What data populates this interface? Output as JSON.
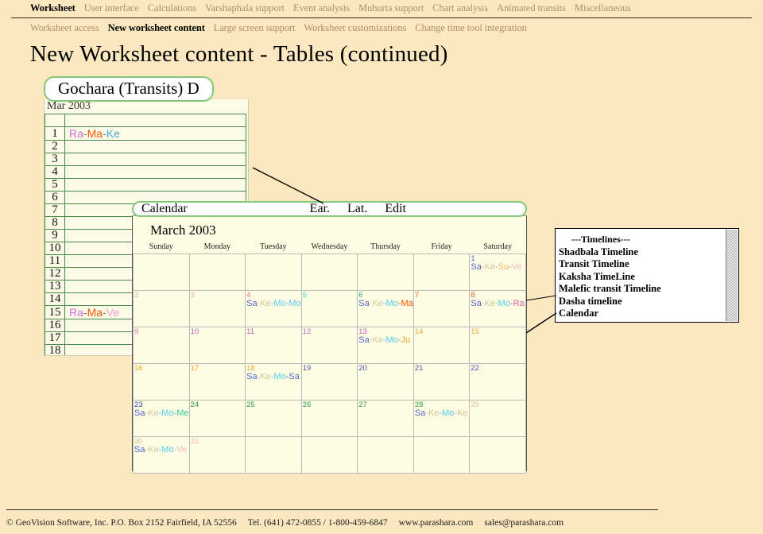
{
  "topnav": {
    "row1": [
      {
        "label": "Worksheet",
        "active": true
      },
      {
        "label": "User interface",
        "active": false
      },
      {
        "label": "Calculations",
        "active": false
      },
      {
        "label": "Varshaphala support",
        "active": false
      },
      {
        "label": "Event analysis",
        "active": false
      },
      {
        "label": "Muhurta support",
        "active": false
      },
      {
        "label": "Chart analysis",
        "active": false
      },
      {
        "label": "Animated transits",
        "active": false
      },
      {
        "label": "Miscellaneous",
        "active": false
      }
    ],
    "row2": [
      {
        "label": "Worksheet access",
        "active": false
      },
      {
        "label": "New worksheet content",
        "active": true
      },
      {
        "label": "Large screen support",
        "active": false
      },
      {
        "label": "Worksheet customizations",
        "active": false
      },
      {
        "label": "Change time tool integration",
        "active": false
      }
    ]
  },
  "page": {
    "title": "New Worksheet content - Tables (continued)"
  },
  "gochara": {
    "title": "Gochara (Transits) D",
    "month_label": "Mar 2003",
    "rows": [
      {
        "num": "",
        "tokens": []
      },
      {
        "num": "1",
        "tokens": [
          {
            "t": "Ra",
            "c": "#d96ad9"
          },
          {
            "t": "-",
            "c": "#777777"
          },
          {
            "t": "Ma",
            "c": "#ff5500"
          },
          {
            "t": "-",
            "c": "#777777"
          },
          {
            "t": "Ke",
            "c": "#44aadd"
          }
        ]
      },
      {
        "num": "2",
        "tokens": []
      },
      {
        "num": "3",
        "tokens": []
      },
      {
        "num": "4",
        "tokens": []
      },
      {
        "num": "5",
        "tokens": []
      },
      {
        "num": "6",
        "tokens": []
      },
      {
        "num": "7",
        "tokens": []
      },
      {
        "num": "8",
        "tokens": []
      },
      {
        "num": "9",
        "tokens": []
      },
      {
        "num": "10",
        "tokens": []
      },
      {
        "num": "11",
        "tokens": []
      },
      {
        "num": "12",
        "tokens": []
      },
      {
        "num": "13",
        "tokens": []
      },
      {
        "num": "14",
        "tokens": []
      },
      {
        "num": "15",
        "tokens": [
          {
            "t": "Ra",
            "c": "#d96ad9"
          },
          {
            "t": "-",
            "c": "#777777"
          },
          {
            "t": "Ma",
            "c": "#ff5500"
          },
          {
            "t": "-",
            "c": "#777777"
          },
          {
            "t": "Ve",
            "c": "#f49ad0"
          }
        ]
      },
      {
        "num": "16",
        "tokens": []
      },
      {
        "num": "17",
        "tokens": []
      },
      {
        "num": "18",
        "tokens": []
      }
    ]
  },
  "calendar": {
    "window_title": "Calendar",
    "actions": [
      "Ear.",
      "Lat.",
      "Edit"
    ],
    "month_title": "March 2003",
    "weekdays": [
      "Sunday",
      "Monday",
      "Tuesday",
      "Wednesday",
      "Thursday",
      "Friday",
      "Saturday"
    ],
    "weeks": [
      [
        {
          "num": "",
          "color": "",
          "tokens": []
        },
        {
          "num": "",
          "color": "",
          "tokens": []
        },
        {
          "num": "",
          "color": "",
          "tokens": []
        },
        {
          "num": "",
          "color": "",
          "tokens": []
        },
        {
          "num": "",
          "color": "",
          "tokens": []
        },
        {
          "num": "",
          "color": "",
          "tokens": []
        },
        {
          "num": "1",
          "color": "#5566cc",
          "tokens": [
            {
              "t": "Sa",
              "c": "#5566cc"
            },
            {
              "t": "-",
              "c": "#aaaaaa"
            },
            {
              "t": "Ke",
              "c": "#d8c0a0"
            },
            {
              "t": "-",
              "c": "#aaaaaa"
            },
            {
              "t": "Su",
              "c": "#f0b860"
            },
            {
              "t": "-",
              "c": "#aaaaaa"
            },
            {
              "t": "Ve",
              "c": "#f4b8c8"
            }
          ]
        }
      ],
      [
        {
          "num": "2",
          "color": "#f4a8c8",
          "tokens": []
        },
        {
          "num": "3",
          "color": "#f4a8c8",
          "tokens": []
        },
        {
          "num": "4",
          "color": "#f46aa0",
          "tokens": [
            {
              "t": "Sa",
              "c": "#5566cc"
            },
            {
              "t": "-",
              "c": "#d8c0a0"
            },
            {
              "t": "Ke",
              "c": "#d8c0a0"
            },
            {
              "t": "-",
              "c": "#55ccee"
            },
            {
              "t": "Mo",
              "c": "#55ccee"
            },
            {
              "t": "-",
              "c": "#55ccee"
            },
            {
              "t": "Mo",
              "c": "#55ccee"
            }
          ]
        },
        {
          "num": "5",
          "color": "#33ccdd",
          "tokens": []
        },
        {
          "num": "6",
          "color": "#33aa88",
          "tokens": [
            {
              "t": "Sa",
              "c": "#5566cc"
            },
            {
              "t": "-",
              "c": "#d8c0a0"
            },
            {
              "t": "Ke",
              "c": "#d8c0a0"
            },
            {
              "t": "-",
              "c": "#55ccee"
            },
            {
              "t": "Mo",
              "c": "#55ccee"
            },
            {
              "t": "-",
              "c": "#ff5500"
            },
            {
              "t": "Ma",
              "c": "#ff5500"
            }
          ]
        },
        {
          "num": "7",
          "color": "#ee6633",
          "tokens": []
        },
        {
          "num": "8",
          "color": "#ee5522",
          "tokens": [
            {
              "t": "Sa",
              "c": "#5566cc"
            },
            {
              "t": "-",
              "c": "#d8c0a0"
            },
            {
              "t": "Ke",
              "c": "#d8c0a0"
            },
            {
              "t": "-",
              "c": "#55ccee"
            },
            {
              "t": "Mo",
              "c": "#55ccee"
            },
            {
              "t": "-",
              "c": "#e060b0"
            },
            {
              "t": "Ra",
              "c": "#e060b0"
            }
          ]
        }
      ],
      [
        {
          "num": "9",
          "color": "#e070d0",
          "tokens": []
        },
        {
          "num": "10",
          "color": "#c060c0",
          "tokens": []
        },
        {
          "num": "11",
          "color": "#c060c0",
          "tokens": []
        },
        {
          "num": "12",
          "color": "#d070c0",
          "tokens": []
        },
        {
          "num": "13",
          "color": "#cc55bb",
          "tokens": [
            {
              "t": "Sa",
              "c": "#5566cc"
            },
            {
              "t": "-",
              "c": "#d8c0a0"
            },
            {
              "t": "Ke",
              "c": "#d8c0a0"
            },
            {
              "t": "-",
              "c": "#55ccee"
            },
            {
              "t": "Mo",
              "c": "#55ccee"
            },
            {
              "t": "-",
              "c": "#f0a030"
            },
            {
              "t": "Ju",
              "c": "#f0a030"
            }
          ]
        },
        {
          "num": "14",
          "color": "#f0a840",
          "tokens": []
        },
        {
          "num": "15",
          "color": "#f0a840",
          "tokens": []
        }
      ],
      [
        {
          "num": "16",
          "color": "#f0a030",
          "tokens": []
        },
        {
          "num": "17",
          "color": "#f0a030",
          "tokens": []
        },
        {
          "num": "18",
          "color": "#f0a030",
          "tokens": [
            {
              "t": "Sa",
              "c": "#5566cc"
            },
            {
              "t": "-",
              "c": "#d8c0a0"
            },
            {
              "t": "Ke",
              "c": "#d8c0a0"
            },
            {
              "t": "-",
              "c": "#55ccee"
            },
            {
              "t": "Mo",
              "c": "#55ccee"
            },
            {
              "t": "-",
              "c": "#5566cc"
            },
            {
              "t": "Sa",
              "c": "#5566cc"
            }
          ]
        },
        {
          "num": "19",
          "color": "#4455bb",
          "tokens": []
        },
        {
          "num": "20",
          "color": "#4455bb",
          "tokens": []
        },
        {
          "num": "21",
          "color": "#4455bb",
          "tokens": []
        },
        {
          "num": "22",
          "color": "#4455bb",
          "tokens": []
        }
      ],
      [
        {
          "num": "23",
          "color": "#3344bb",
          "tokens": [
            {
              "t": "Sa",
              "c": "#5566cc"
            },
            {
              "t": "-",
              "c": "#d8c0a0"
            },
            {
              "t": "Ke",
              "c": "#d8c0a0"
            },
            {
              "t": "-",
              "c": "#55ccee"
            },
            {
              "t": "Mo",
              "c": "#55ccee"
            },
            {
              "t": "-",
              "c": "#33cc99"
            },
            {
              "t": "Me",
              "c": "#33cc99"
            }
          ]
        },
        {
          "num": "24",
          "color": "#2f9a4f",
          "tokens": []
        },
        {
          "num": "25",
          "color": "#2f9a4f",
          "tokens": []
        },
        {
          "num": "26",
          "color": "#2f9a4f",
          "tokens": []
        },
        {
          "num": "27",
          "color": "#2f9a4f",
          "tokens": []
        },
        {
          "num": "28",
          "color": "#2f9a4f",
          "tokens": [
            {
              "t": "Sa",
              "c": "#5566cc"
            },
            {
              "t": "-",
              "c": "#d8c0a0"
            },
            {
              "t": "Ke",
              "c": "#d8c0a0"
            },
            {
              "t": "-",
              "c": "#55ccee"
            },
            {
              "t": "Mo",
              "c": "#55ccee"
            },
            {
              "t": "-",
              "c": "#d8c0a0"
            },
            {
              "t": "Ke",
              "c": "#d8c0a0"
            }
          ]
        },
        {
          "num": "29",
          "color": "#d8c0a0",
          "tokens": []
        }
      ],
      [
        {
          "num": "30",
          "color": "#d8c0a0",
          "tokens": [
            {
              "t": "Sa",
              "c": "#5566cc"
            },
            {
              "t": "-",
              "c": "#d8c0a0"
            },
            {
              "t": "Ke",
              "c": "#d8c0a0"
            },
            {
              "t": "-",
              "c": "#55ccee"
            },
            {
              "t": "Mo",
              "c": "#55ccee"
            },
            {
              "t": "-",
              "c": "#f4b8c8"
            },
            {
              "t": "Ve",
              "c": "#f4b8c8"
            }
          ]
        },
        {
          "num": "31",
          "color": "#f4b8c8",
          "tokens": []
        },
        {
          "num": "",
          "color": "",
          "tokens": []
        },
        {
          "num": "",
          "color": "",
          "tokens": []
        },
        {
          "num": "",
          "color": "",
          "tokens": []
        },
        {
          "num": "",
          "color": "",
          "tokens": []
        },
        {
          "num": "",
          "color": "",
          "tokens": []
        }
      ]
    ]
  },
  "timelines": {
    "header": "---Timelines---",
    "items": [
      "Shadbala Timeline",
      "Transit Timeline",
      "Kaksha TimeLine",
      "Malefic transit Timeline",
      "Dasha timeline",
      "Calendar"
    ]
  },
  "footer": {
    "segments": [
      "© GeoVision Software, Inc. P.O. Box 2152 Fairfield, IA 52556",
      "Tel. (641) 472-0855 / 1-800-459-6847",
      "www.parashara.com",
      "sales@parashara.com"
    ]
  }
}
